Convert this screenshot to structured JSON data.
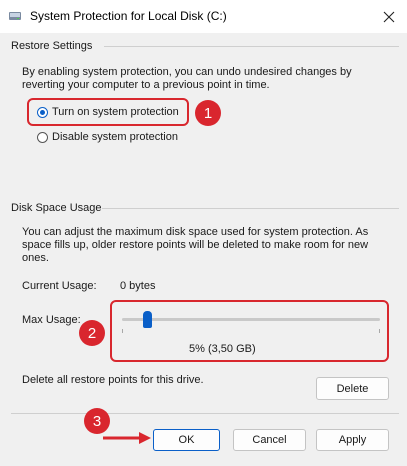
{
  "window": {
    "title": "System Protection for Local Disk (C:)",
    "close_icon": "close-icon"
  },
  "restore_settings": {
    "heading": "Restore Settings",
    "description_line1": "By enabling system protection, you can undo undesired changes by",
    "description_line2": "reverting your computer to a previous point in time.",
    "option_on": "Turn on system protection",
    "option_off": "Disable system protection",
    "selected": "Turn on system protection"
  },
  "disk_space": {
    "heading": "Disk Space Usage",
    "description_line1": "You can adjust the maximum disk space used for system protection. As",
    "description_line2": "space fills up, older restore points will be deleted to make room for new",
    "description_line3": "ones.",
    "current_usage_label": "Current Usage:",
    "current_usage_value": "0 bytes",
    "max_usage_label": "Max Usage:",
    "max_usage_percent": 5,
    "max_usage_value": "5% (3,50 GB)",
    "delete_text": "Delete all restore points for this drive.",
    "delete_button": "Delete"
  },
  "footer": {
    "ok": "OK",
    "cancel": "Cancel",
    "apply": "Apply"
  },
  "annotations": {
    "badge1": "1",
    "badge2": "2",
    "badge3": "3",
    "highlight_color": "#d8272e"
  },
  "colors": {
    "accent": "#0a5fc8",
    "annotation_red": "#d9262e"
  }
}
